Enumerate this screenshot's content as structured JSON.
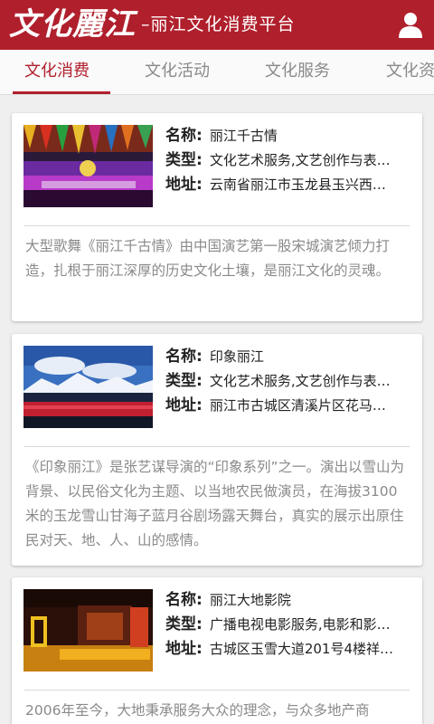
{
  "header": {
    "logo": "文化麗江",
    "subtitle": "–丽江文化消费平台",
    "user_icon": "user-icon",
    "bg_color": "#b01f2c"
  },
  "tabs": [
    {
      "label": "文化消费",
      "active": true
    },
    {
      "label": "文化活动",
      "active": false
    },
    {
      "label": "文化服务",
      "active": false
    },
    {
      "label": "文化资",
      "active": false
    }
  ],
  "cards": [
    {
      "name_key": "名称:",
      "name": "丽江千古情",
      "type_key": "类型:",
      "type": "文化艺术服务,文艺创作与表…",
      "addr_key": "地址:",
      "addr": "云南省丽江市玉龙县玉兴西…",
      "desc": "大型歌舞《丽江千古情》由中国演艺第一股宋城演艺倾力打造，扎根于丽江深厚的历史文化土壤，是丽江文化的灵魂。"
    },
    {
      "name_key": "名称:",
      "name": "印象丽江",
      "type_key": "类型:",
      "type": "文化艺术服务,文艺创作与表…",
      "addr_key": "地址:",
      "addr": "丽江市古城区清溪片区花马…",
      "desc": "《印象丽江》是张艺谋导演的“印象系列”之一。演出以雪山为背景、以民俗文化为主题、以当地农民做演员，在海拔3100米的玉龙雪山甘海子蓝月谷剧场露天舞台，真实的展示出原住民对天、地、人、山的感情。"
    },
    {
      "name_key": "名称:",
      "name": "丽江大地影院",
      "type_key": "类型:",
      "type": "广播电视电影服务,电影和影…",
      "addr_key": "地址:",
      "addr": "古城区玉雪大道201号4楼祥…",
      "desc": "2006年至今，大地秉承服务大众的理念，与众多地产商"
    }
  ]
}
